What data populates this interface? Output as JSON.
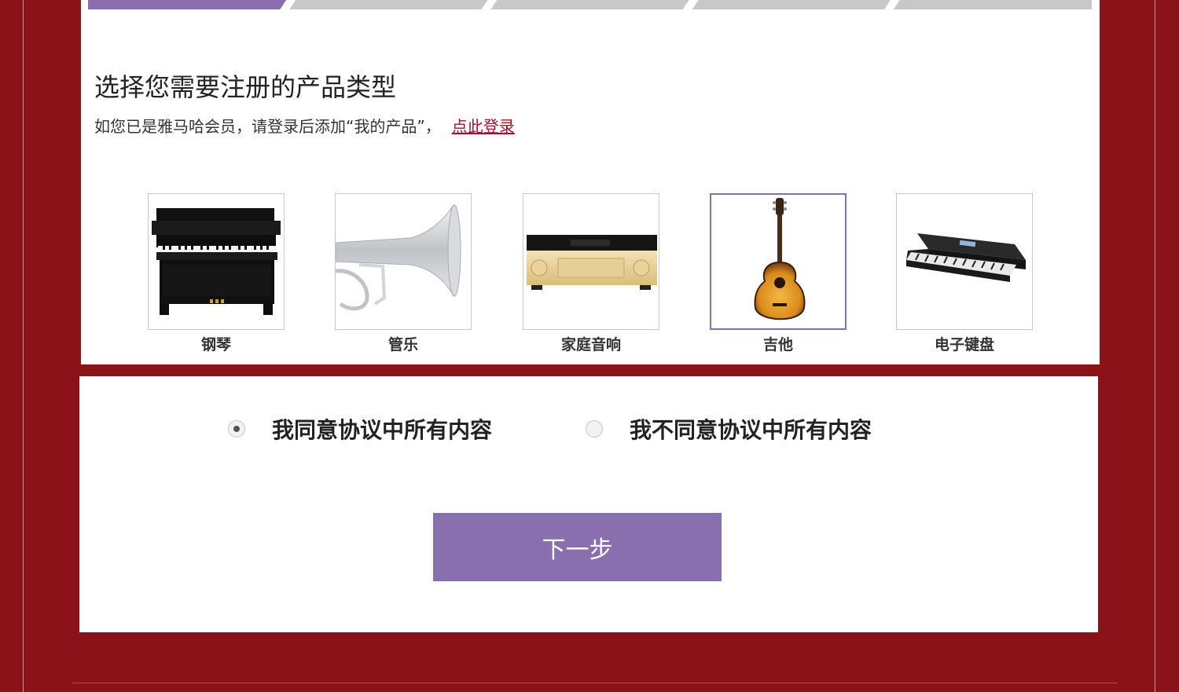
{
  "progress": {
    "total_steps": 5,
    "current_step": 1
  },
  "heading": {
    "title": "选择您需要注册的产品类型",
    "member_note": "如您已是雅马哈会员，请登录后添加“我的产品”，",
    "login_link": "点此登录"
  },
  "categories": [
    {
      "label": "钢琴",
      "icon": "piano-icon"
    },
    {
      "label": "管乐",
      "icon": "trumpet-icon"
    },
    {
      "label": "家庭音响",
      "icon": "av-receiver-icon"
    },
    {
      "label": "吉他",
      "icon": "guitar-icon",
      "selected": true
    },
    {
      "label": "电子键盘",
      "icon": "keyboard-icon"
    }
  ],
  "agreement": {
    "agree_label": "我同意协议中所有内容",
    "disagree_label": "我不同意协议中所有内容",
    "selected": "agree"
  },
  "next_button_label": "下一步",
  "colors": {
    "background": "#8b1219",
    "accent": "#8a6fae",
    "link": "#a2122a"
  }
}
